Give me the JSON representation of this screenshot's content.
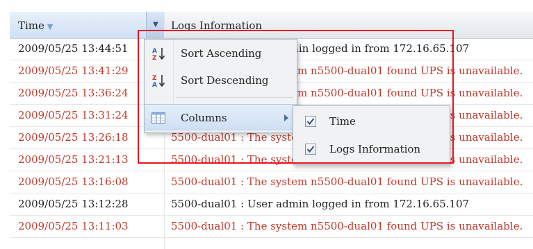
{
  "grid": {
    "columns": [
      {
        "label": "Time",
        "sort": "asc"
      },
      {
        "label": "Logs Information"
      }
    ],
    "rows": [
      {
        "time": "2009/05/25 13:44:51",
        "info": "5500-dual01 : User admin logged in from 172.16.65.107",
        "level": "info"
      },
      {
        "time": "2009/05/25 13:41:29",
        "info": "5500-dual01 : The system n5500-dual01 found UPS is unavailable.",
        "level": "error"
      },
      {
        "time": "2009/05/25 13:36:24",
        "info": "5500-dual01 : The system n5500-dual01 found UPS is unavailable.",
        "level": "error"
      },
      {
        "time": "2009/05/25 13:31:24",
        "info": "5500-dual01 : The system n5500-dual01 found UPS is unavailable.",
        "level": "error"
      },
      {
        "time": "2009/05/25 13:26:18",
        "info": "5500-dual01 : The system n5500-dual01 found UPS is unavailable.",
        "level": "error"
      },
      {
        "time": "2009/05/25 13:21:13",
        "info": "5500-dual01 : The system n5500-dual01 found UPS is unavailable.",
        "level": "error"
      },
      {
        "time": "2009/05/25 13:16:08",
        "info": "5500-dual01 : The system n5500-dual01 found UPS is unavailable.",
        "level": "error"
      },
      {
        "time": "2009/05/25 13:12:28",
        "info": "5500-dual01 : User admin logged in from 172.16.65.107",
        "level": "info"
      },
      {
        "time": "2009/05/25 13:11:03",
        "info": "5500-dual01 : The system n5500-dual01 found UPS is unavailable.",
        "level": "error"
      }
    ]
  },
  "menu": {
    "sort_asc": "Sort Ascending",
    "sort_desc": "Sort Descending",
    "columns": "Columns",
    "icons": {
      "sort_asc": "sort-ascending-icon",
      "sort_desc": "sort-descending-icon",
      "columns": "columns-icon"
    }
  },
  "columns_submenu": [
    {
      "label": "Time",
      "checked": true
    },
    {
      "label": "Logs Information",
      "checked": true
    }
  ],
  "colors": {
    "error_text": "#c0392b",
    "highlight_border": "#e8141e",
    "menu_hover": "#cfe0f4"
  }
}
